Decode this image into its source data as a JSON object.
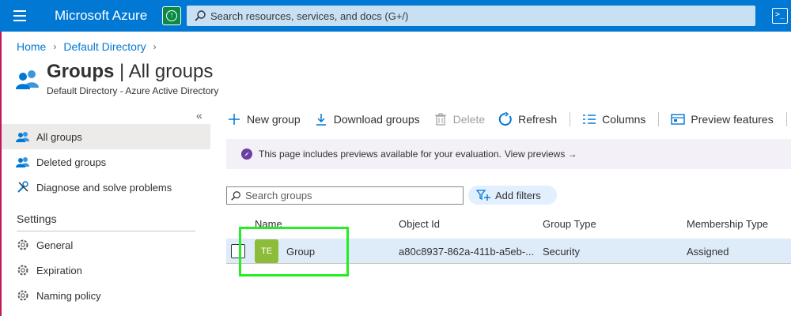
{
  "topbar": {
    "brand": "Microsoft Azure",
    "search_placeholder": "Search resources, services, and docs (G+/)",
    "accent": "#0078d4"
  },
  "breadcrumb": {
    "items": [
      "Home",
      "Default Directory"
    ]
  },
  "page": {
    "title_bold": "Groups",
    "title_rest": " | All groups",
    "subtitle": "Default Directory - Azure Active Directory"
  },
  "nav": {
    "items": [
      {
        "label": "All groups",
        "icon": "groups-icon"
      },
      {
        "label": "Deleted groups",
        "icon": "groups-icon"
      },
      {
        "label": "Diagnose and solve problems",
        "icon": "wrench-icon"
      }
    ],
    "settings_heading": "Settings",
    "settings_items": [
      {
        "label": "General",
        "icon": "gear-icon"
      },
      {
        "label": "Expiration",
        "icon": "gear-icon"
      },
      {
        "label": "Naming policy",
        "icon": "gear-icon"
      }
    ]
  },
  "toolbar": {
    "new_group": "New group",
    "download_groups": "Download groups",
    "delete": "Delete",
    "refresh": "Refresh",
    "columns": "Columns",
    "preview_features": "Preview features"
  },
  "banner": {
    "text": "This page includes previews available for your evaluation.",
    "link": "View previews →"
  },
  "filters": {
    "search_placeholder": "Search groups",
    "add_filters": "Add filters"
  },
  "table": {
    "headers": [
      "Name",
      "Object Id",
      "Group Type",
      "Membership Type"
    ],
    "rows": [
      {
        "initials": "TE",
        "name": "Group",
        "object_id": "a80c8937-862a-411b-a5eb-...",
        "group_type": "Security",
        "membership_type": "Assigned",
        "avatar_color": "#8cbd3a"
      }
    ]
  }
}
